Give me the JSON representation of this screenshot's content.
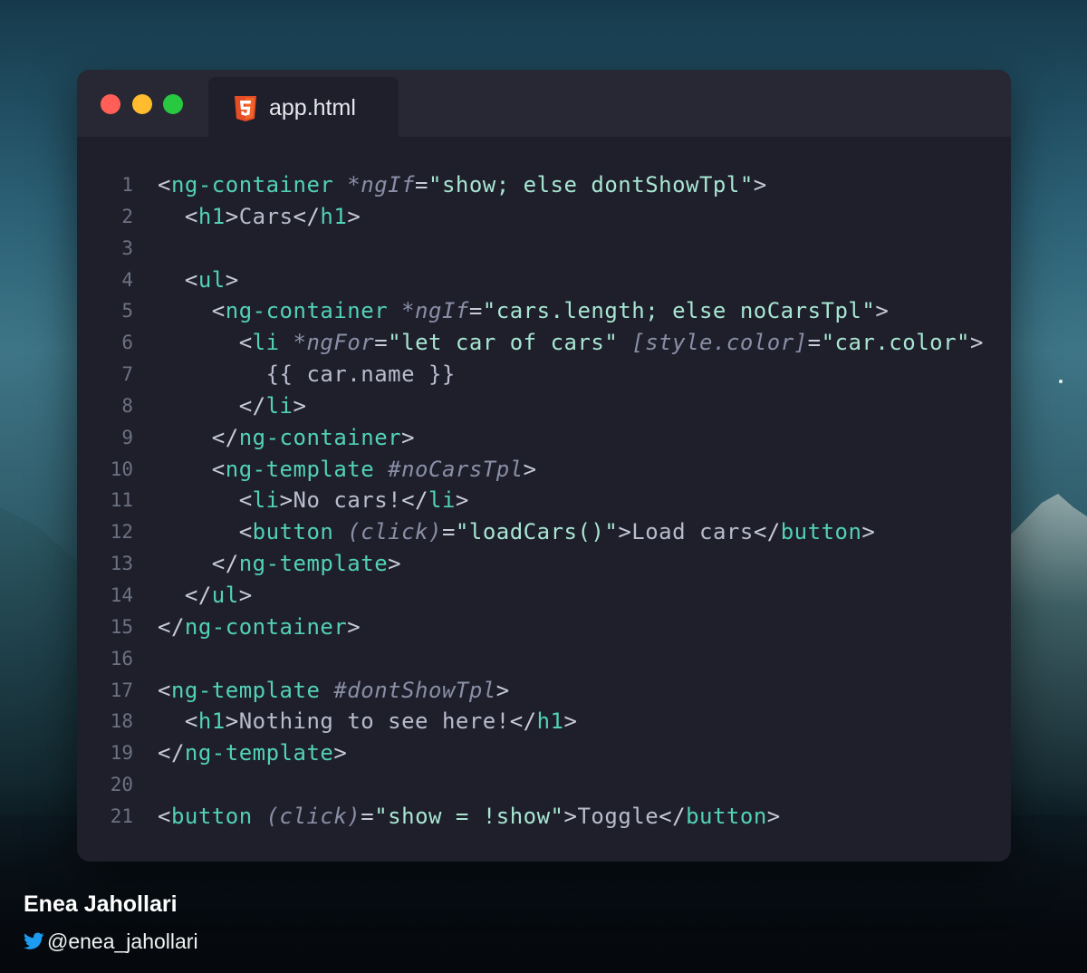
{
  "tab": {
    "filename": "app.html",
    "icon": "html5-icon"
  },
  "window_controls": [
    {
      "name": "close-dot",
      "color": "#ff5f57"
    },
    {
      "name": "minimize-dot",
      "color": "#febc2e"
    },
    {
      "name": "maximize-dot",
      "color": "#28c840"
    }
  ],
  "colors": {
    "tag": "#52d1b7",
    "attribute": "#8a8fa6",
    "string": "#a8e6d2",
    "text": "#b9bccd",
    "punctuation": "#c8ccd8",
    "line_number": "#6d7182",
    "editor_bg": "#1e1f2b"
  },
  "code_lines": [
    {
      "n": "1",
      "tokens": [
        [
          "p",
          "<"
        ],
        [
          "t",
          "ng-container"
        ],
        [
          "p",
          " "
        ],
        [
          "a",
          "*ngIf"
        ],
        [
          "p",
          "="
        ],
        [
          "s",
          "\"show; else dontShowTpl\""
        ],
        [
          "p",
          ">"
        ]
      ]
    },
    {
      "n": "2",
      "tokens": [
        [
          "p",
          "  <"
        ],
        [
          "t",
          "h1"
        ],
        [
          "p",
          ">"
        ],
        [
          "x",
          "Cars"
        ],
        [
          "p",
          "</"
        ],
        [
          "t",
          "h1"
        ],
        [
          "p",
          ">"
        ]
      ]
    },
    {
      "n": "3",
      "tokens": []
    },
    {
      "n": "4",
      "tokens": [
        [
          "p",
          "  <"
        ],
        [
          "t",
          "ul"
        ],
        [
          "p",
          ">"
        ]
      ]
    },
    {
      "n": "5",
      "tokens": [
        [
          "p",
          "    <"
        ],
        [
          "t",
          "ng-container"
        ],
        [
          "p",
          " "
        ],
        [
          "a",
          "*ngIf"
        ],
        [
          "p",
          "="
        ],
        [
          "s",
          "\"cars.length; else noCarsTpl\""
        ],
        [
          "p",
          ">"
        ]
      ]
    },
    {
      "n": "6",
      "tokens": [
        [
          "p",
          "      <"
        ],
        [
          "t",
          "li"
        ],
        [
          "p",
          " "
        ],
        [
          "a",
          "*ngFor"
        ],
        [
          "p",
          "="
        ],
        [
          "s",
          "\"let car of cars\""
        ],
        [
          "p",
          " "
        ],
        [
          "a",
          "[style.color]"
        ],
        [
          "p",
          "="
        ],
        [
          "s",
          "\"car.color\""
        ],
        [
          "p",
          ">"
        ]
      ]
    },
    {
      "n": "7",
      "tokens": [
        [
          "x",
          "        {{ car.name }}"
        ]
      ]
    },
    {
      "n": "8",
      "tokens": [
        [
          "p",
          "      </"
        ],
        [
          "t",
          "li"
        ],
        [
          "p",
          ">"
        ]
      ]
    },
    {
      "n": "9",
      "tokens": [
        [
          "p",
          "    </"
        ],
        [
          "t",
          "ng-container"
        ],
        [
          "p",
          ">"
        ]
      ]
    },
    {
      "n": "10",
      "tokens": [
        [
          "p",
          "    <"
        ],
        [
          "t",
          "ng-template"
        ],
        [
          "p",
          " "
        ],
        [
          "a",
          "#noCarsTpl"
        ],
        [
          "p",
          ">"
        ]
      ]
    },
    {
      "n": "11",
      "tokens": [
        [
          "p",
          "      <"
        ],
        [
          "t",
          "li"
        ],
        [
          "p",
          ">"
        ],
        [
          "x",
          "No cars!"
        ],
        [
          "p",
          "</"
        ],
        [
          "t",
          "li"
        ],
        [
          "p",
          ">"
        ]
      ]
    },
    {
      "n": "12",
      "tokens": [
        [
          "p",
          "      <"
        ],
        [
          "t",
          "button"
        ],
        [
          "p",
          " "
        ],
        [
          "a",
          "(click)"
        ],
        [
          "p",
          "="
        ],
        [
          "s",
          "\"loadCars()\""
        ],
        [
          "p",
          ">"
        ],
        [
          "x",
          "Load cars"
        ],
        [
          "p",
          "</"
        ],
        [
          "t",
          "button"
        ],
        [
          "p",
          ">"
        ]
      ]
    },
    {
      "n": "13",
      "tokens": [
        [
          "p",
          "    </"
        ],
        [
          "t",
          "ng-template"
        ],
        [
          "p",
          ">"
        ]
      ]
    },
    {
      "n": "14",
      "tokens": [
        [
          "p",
          "  </"
        ],
        [
          "t",
          "ul"
        ],
        [
          "p",
          ">"
        ]
      ]
    },
    {
      "n": "15",
      "tokens": [
        [
          "p",
          "</"
        ],
        [
          "t",
          "ng-container"
        ],
        [
          "p",
          ">"
        ]
      ]
    },
    {
      "n": "16",
      "tokens": []
    },
    {
      "n": "17",
      "tokens": [
        [
          "p",
          "<"
        ],
        [
          "t",
          "ng-template"
        ],
        [
          "p",
          " "
        ],
        [
          "a",
          "#dontShowTpl"
        ],
        [
          "p",
          ">"
        ]
      ]
    },
    {
      "n": "18",
      "tokens": [
        [
          "p",
          "  <"
        ],
        [
          "t",
          "h1"
        ],
        [
          "p",
          ">"
        ],
        [
          "x",
          "Nothing to see here!"
        ],
        [
          "p",
          "</"
        ],
        [
          "t",
          "h1"
        ],
        [
          "p",
          ">"
        ]
      ]
    },
    {
      "n": "19",
      "tokens": [
        [
          "p",
          "</"
        ],
        [
          "t",
          "ng-template"
        ],
        [
          "p",
          ">"
        ]
      ]
    },
    {
      "n": "20",
      "tokens": []
    },
    {
      "n": "21",
      "tokens": [
        [
          "p",
          "<"
        ],
        [
          "t",
          "button"
        ],
        [
          "p",
          " "
        ],
        [
          "a",
          "(click)"
        ],
        [
          "p",
          "="
        ],
        [
          "s",
          "\"show = !show\""
        ],
        [
          "p",
          ">"
        ],
        [
          "x",
          "Toggle"
        ],
        [
          "p",
          "</"
        ],
        [
          "t",
          "button"
        ],
        [
          "p",
          ">"
        ]
      ]
    }
  ],
  "author": {
    "name": "Enea Jahollari",
    "handle": "@enea_jahollari",
    "icon": "twitter-bird-icon"
  }
}
